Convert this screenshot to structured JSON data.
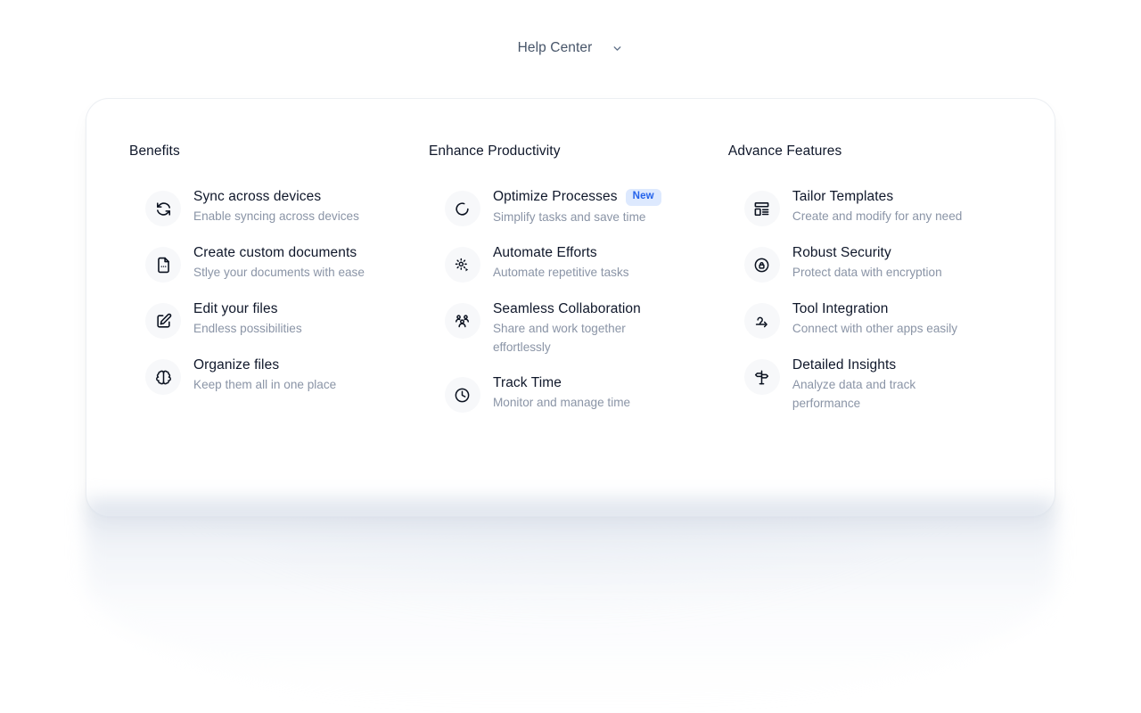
{
  "nav": {
    "label": "Help Center",
    "chevron_icon": "chevron-down-icon"
  },
  "colors": {
    "page_background": "#ffffff",
    "card_background": "#ffffff",
    "card_border": "#eceff3",
    "icon_circle_background": "#f7f8fa",
    "title_text": "#0f172a",
    "description_text": "#8a94a6",
    "nav_text": "#475569",
    "badge_text": "#2563eb",
    "badge_background": "#dde9fe"
  },
  "columns": [
    {
      "title": "Benefits",
      "items": [
        {
          "icon": "sync-icon",
          "title": "Sync across devices",
          "description": "Enable syncing across devices",
          "badge": null
        },
        {
          "icon": "document-icon",
          "title": "Create custom documents",
          "description": "Stlye your documents with ease",
          "badge": null
        },
        {
          "icon": "edit-pencil-icon",
          "title": "Edit your files",
          "description": "Endless possibilities",
          "badge": null
        },
        {
          "icon": "brain-icon",
          "title": "Organize files",
          "description": "Keep them all in one place",
          "badge": null
        }
      ]
    },
    {
      "title": "Enhance Productivity",
      "items": [
        {
          "icon": "loader-spinner-icon",
          "title": "Optimize Processes",
          "description": "Simplify tasks and save time",
          "badge": "New"
        },
        {
          "icon": "gear-play-icon",
          "title": "Automate Efforts",
          "description": "Automate repetitive tasks",
          "badge": null
        },
        {
          "icon": "users-group-icon",
          "title": "Seamless Collaboration",
          "description": "Share and work together effortlessly",
          "badge": null
        },
        {
          "icon": "clock-icon",
          "title": "Track Time",
          "description": "Monitor and manage time",
          "badge": null
        }
      ]
    },
    {
      "title": "Advance Features",
      "items": [
        {
          "icon": "layout-template-icon",
          "title": "Tailor Templates",
          "description": "Create and modify for any need",
          "badge": null
        },
        {
          "icon": "lock-shield-icon",
          "title": "Robust Security",
          "description": "Protect data with encryption",
          "badge": null
        },
        {
          "icon": "plug-connector-icon",
          "title": "Tool Integration",
          "description": "Connect with other apps easily",
          "badge": null
        },
        {
          "icon": "signpost-icon",
          "title": "Detailed Insights",
          "description": "Analyze data and track performance",
          "badge": null
        }
      ]
    }
  ]
}
